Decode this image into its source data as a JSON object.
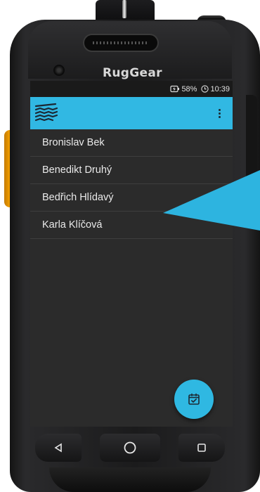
{
  "device": {
    "brand": "RugGear"
  },
  "status_bar": {
    "battery": "58%",
    "time": "10:39",
    "icons": [
      "battery-charging-icon",
      "clock-icon"
    ]
  },
  "app_bar": {
    "logo_icon": "app-logo-icon",
    "menu_icon": "more-vertical-icon"
  },
  "contacts": [
    {
      "name": "Bronislav Bek"
    },
    {
      "name": "Benedikt Druhý"
    },
    {
      "name": "Bedřich Hlídavý"
    },
    {
      "name": "Karla Klíčová"
    }
  ],
  "fab": {
    "icon": "calendar-check-icon"
  },
  "nav": {
    "back_icon": "back-triangle-icon",
    "home_icon": "home-circle-icon",
    "recent_icon": "recent-square-icon"
  },
  "colors": {
    "accent": "#31b8e3",
    "screen_bg": "#2b2b2b",
    "status_bg": "#1a1a1a",
    "text": "#eaeaea",
    "side_button": "#f4a000"
  }
}
